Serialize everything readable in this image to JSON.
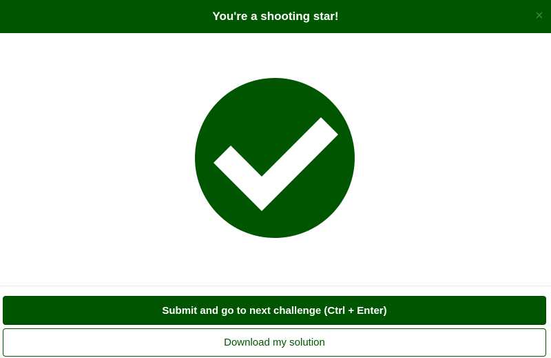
{
  "header": {
    "title": "You're a shooting star!",
    "close_label": "×"
  },
  "success_icon": {
    "name": "check-circle-icon",
    "color": "#005600"
  },
  "actions": {
    "submit_label": "Submit and go to next challenge (Ctrl + Enter)",
    "download_label": "Download my solution"
  },
  "colors": {
    "brand": "#005600",
    "background": "#ffffff"
  }
}
